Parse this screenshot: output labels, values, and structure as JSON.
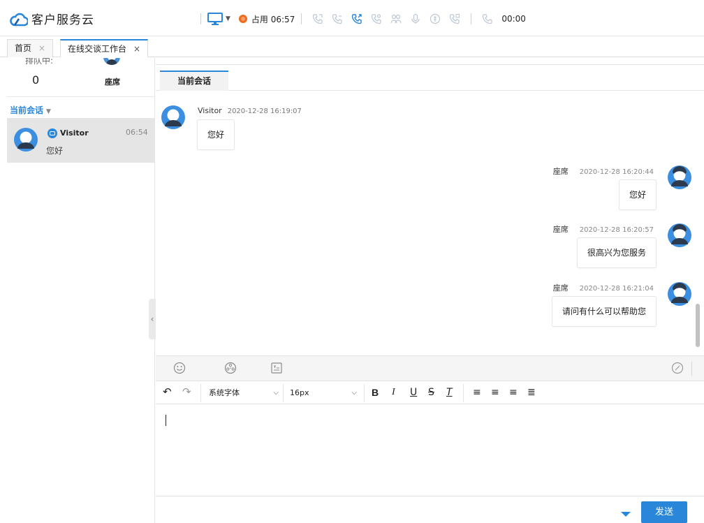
{
  "app": {
    "title": "客户服务云"
  },
  "callbar": {
    "status": "占用 06:57",
    "timer": "00:00"
  },
  "tabs": [
    {
      "label": "首页"
    },
    {
      "label": "在线交谈工作台"
    }
  ],
  "sidebar": {
    "stats": {
      "queue_label": "排队中:",
      "queue_count": "0",
      "agent_label": "座席"
    },
    "section_title": "当前会话",
    "sessions": [
      {
        "name": "Visitor",
        "time": "06:54",
        "preview": "您好"
      }
    ]
  },
  "conversation": {
    "tab_label": "当前会话",
    "messages": [
      {
        "side": "left",
        "sender": "Visitor",
        "time": "2020-12-28 16:19:07",
        "text": "您好"
      },
      {
        "side": "right",
        "sender": "座席",
        "time": "2020-12-28 16:20:44",
        "text": "您好"
      },
      {
        "side": "right",
        "sender": "座席",
        "time": "2020-12-28 16:20:57",
        "text": "很高兴为您服务"
      },
      {
        "side": "right",
        "sender": "座席",
        "time": "2020-12-28 16:21:04",
        "text": "请问有什么可以帮助您"
      }
    ]
  },
  "editor": {
    "font_family": "系统字体",
    "font_size": "16px",
    "send_label": "发送"
  },
  "colors": {
    "accent": "#2a86d8",
    "status_busy": "#f06c1d"
  }
}
